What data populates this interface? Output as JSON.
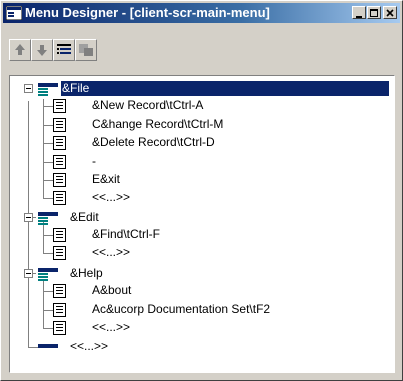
{
  "window": {
    "title": "Menu Designer - [client-scr-main-menu]"
  },
  "toolbar": {
    "buttons": [
      {
        "name": "move-up",
        "icon": "arrow-up-icon"
      },
      {
        "name": "move-down",
        "icon": "arrow-down-icon"
      },
      {
        "name": "properties",
        "icon": "list-properties-icon"
      },
      {
        "name": "insert",
        "icon": "insert-menu-icon"
      }
    ]
  },
  "tree": {
    "file": {
      "label": "&File",
      "items": [
        "&New Record\\tCtrl-A",
        "C&hange Record\\tCtrl-M",
        "&Delete Record\\tCtrl-D",
        "-",
        "E&xit",
        "<<...>>"
      ]
    },
    "edit": {
      "label": "&Edit",
      "items": [
        "&Find\\tCtrl-F",
        "<<...>>"
      ]
    },
    "help": {
      "label": "&Help",
      "items": [
        "A&bout",
        "Ac&ucorp Documentation Set\\tF2",
        "<<...>>"
      ]
    },
    "root_placeholder": "<<...>>"
  },
  "colors": {
    "selection": "#0a246a",
    "title_start": "#0a246a",
    "title_end": "#a6caf0"
  }
}
